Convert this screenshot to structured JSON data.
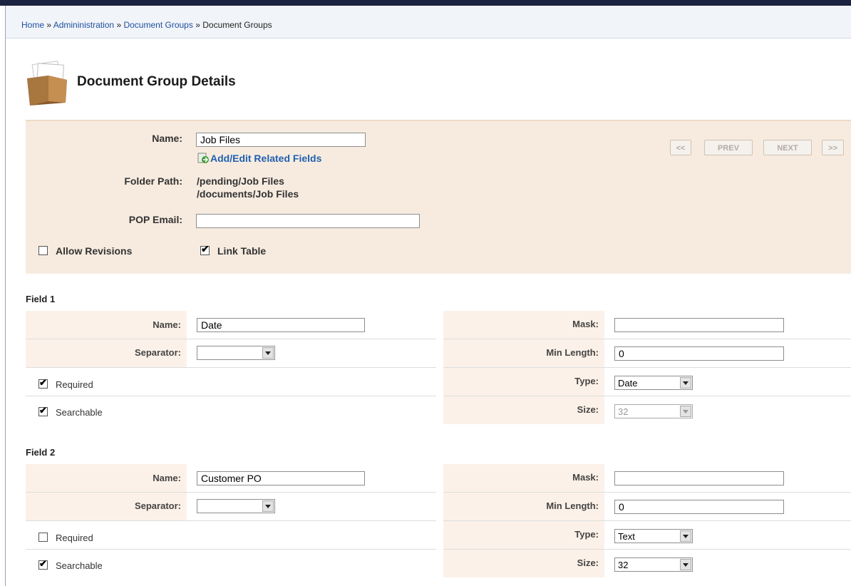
{
  "breadcrumb": {
    "home": "Home",
    "sep": "»",
    "administration": "Admininistration",
    "document_groups": "Document Groups",
    "current": "Document Groups"
  },
  "page": {
    "title": "Document Group Details",
    "icon": "folder-icon"
  },
  "details": {
    "name_label": "Name:",
    "name_value": "Job Files",
    "related_link": "Add/Edit Related Fields",
    "folder_label": "Folder Path:",
    "folder_paths": [
      "/pending/Job Files",
      "/documents/Job Files"
    ],
    "pop_label": "POP Email:",
    "pop_value": "",
    "allow_revisions": {
      "label": "Allow Revisions",
      "checked": false
    },
    "link_table": {
      "label": "Link Table",
      "checked": true
    },
    "nav": {
      "first": "<<",
      "prev": "PREV",
      "next": "NEXT",
      "last": ">>"
    }
  },
  "fields": [
    {
      "title": "Field 1",
      "name_label": "Name:",
      "name_value": "Date",
      "separator_label": "Separator:",
      "separator_value": "",
      "required": {
        "label": "Required",
        "checked": true
      },
      "searchable": {
        "label": "Searchable",
        "checked": true
      },
      "mask_label": "Mask:",
      "mask_value": "",
      "minlen_label": "Min Length:",
      "minlen_value": "0",
      "type_label": "Type:",
      "type_value": "Date",
      "size_label": "Size:",
      "size_value": "32",
      "size_disabled": true
    },
    {
      "title": "Field 2",
      "name_label": "Name:",
      "name_value": "Customer PO",
      "separator_label": "Separator:",
      "separator_value": "",
      "required": {
        "label": "Required",
        "checked": false
      },
      "searchable": {
        "label": "Searchable",
        "checked": true
      },
      "mask_label": "Mask:",
      "mask_value": "",
      "minlen_label": "Min Length:",
      "minlen_value": "0",
      "type_label": "Type:",
      "type_value": "Text",
      "size_label": "Size:",
      "size_value": "32",
      "size_disabled": false
    }
  ]
}
